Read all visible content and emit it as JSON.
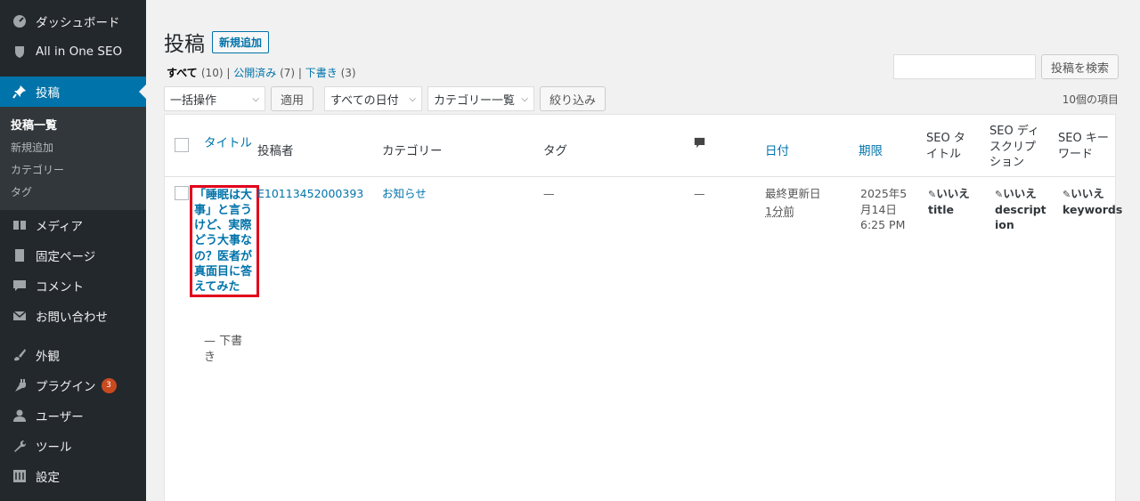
{
  "sidebar": {
    "items": [
      {
        "label": "ダッシュボード",
        "icon": "dashboard-icon"
      },
      {
        "label": "All in One SEO",
        "icon": "shield-icon"
      },
      {
        "label": "投稿",
        "icon": "pin-icon"
      },
      {
        "label": "メディア",
        "icon": "media-icon"
      },
      {
        "label": "固定ページ",
        "icon": "page-icon"
      },
      {
        "label": "コメント",
        "icon": "comment-icon"
      },
      {
        "label": "お問い合わせ",
        "icon": "mail-icon"
      },
      {
        "label": "外観",
        "icon": "brush-icon"
      },
      {
        "label": "プラグイン",
        "icon": "plugin-icon",
        "badge": "3"
      },
      {
        "label": "ユーザー",
        "icon": "user-icon"
      },
      {
        "label": "ツール",
        "icon": "wrench-icon"
      },
      {
        "label": "設定",
        "icon": "settings-icon"
      }
    ],
    "submenu": [
      "投稿一覧",
      "新規追加",
      "カテゴリー",
      "タグ"
    ]
  },
  "header": {
    "title": "投稿",
    "add_new": "新規追加"
  },
  "views": {
    "all": "すべて",
    "all_count": "(10)",
    "published": "公開済み",
    "published_count": "(7)",
    "draft": "下書き",
    "draft_count": "(3)",
    "sep": "|"
  },
  "search": {
    "button": "投稿を検索",
    "value": ""
  },
  "tablenav": {
    "bulk": "一括操作",
    "apply": "適用",
    "dates": "すべての日付",
    "cats": "カテゴリー一覧",
    "filter": "絞り込み",
    "count": "10個の項目"
  },
  "columns": {
    "title": "タイトル",
    "author": "投稿者",
    "category": "カテゴリー",
    "tag": "タグ",
    "date": "日付",
    "deadline": "期限",
    "seo_title": "SEO タイトル",
    "seo_desc": "SEO ディスクリプション",
    "seo_kw": "SEO キーワード"
  },
  "row": {
    "title": "「睡眠は大事」と言うけど、実際どう大事なの？医者が真面目に答えてみた",
    "state": "— 下書き",
    "author": "E10113452000393",
    "category": "お知らせ",
    "tag": "—",
    "comments": "—",
    "date_status": "最終更新日",
    "date_rel": "1分前",
    "deadline": "2025年5月14日 6:25 PM",
    "seo_title": "いいえ title",
    "seo_desc": "いいえ description",
    "seo_kw": "いいえ keywords"
  },
  "colors": {
    "sidebar_bg": "#23282d",
    "accent": "#0073aa",
    "highlight": "#e2001a"
  }
}
